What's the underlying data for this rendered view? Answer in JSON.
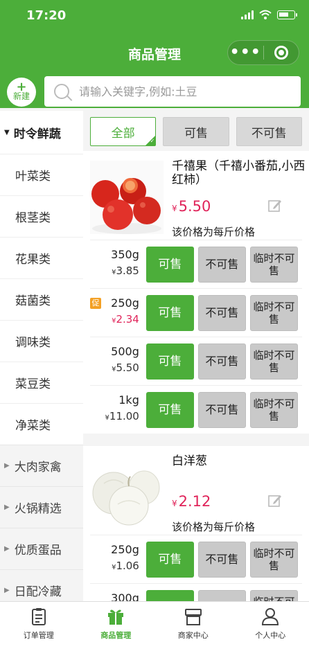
{
  "status": {
    "time": "17:20"
  },
  "nav": {
    "title": "商品管理"
  },
  "toolbar": {
    "new_label": "新建",
    "new_plus": "+",
    "search_placeholder": "请输入关键字,例如:土豆"
  },
  "sidebar": {
    "current": "时令鲜蔬",
    "subcategories": [
      "叶菜类",
      "根茎类",
      "花果类",
      "菇菌类",
      "调味类",
      "菜豆类",
      "净菜类"
    ],
    "other_categories": [
      "大肉家禽",
      "火锅精选",
      "优质蛋品",
      "日配冷藏"
    ]
  },
  "filter_tabs": [
    "全部",
    "可售",
    "不可售"
  ],
  "products": [
    {
      "name": "千禧果（千禧小番茄,小西红柿）",
      "currency": "¥",
      "price": "5.50",
      "note": "该价格为每斤价格",
      "variants": [
        {
          "weight": "350g",
          "price": "3.85",
          "promo": false
        },
        {
          "weight": "250g",
          "price": "2.34",
          "promo": true,
          "promo_label": "促"
        },
        {
          "weight": "500g",
          "price": "5.50",
          "promo": false
        },
        {
          "weight": "1kg",
          "price": "11.00",
          "promo": false
        }
      ]
    },
    {
      "name": "白洋葱",
      "currency": "¥",
      "price": "2.12",
      "note": "该价格为每斤价格",
      "variants": [
        {
          "weight": "250g",
          "price": "1.06",
          "promo": false
        },
        {
          "weight": "300g",
          "price": "",
          "promo": false
        }
      ]
    }
  ],
  "variant_buttons": {
    "on": "可售",
    "off": "不可售",
    "temp": "临时不可售"
  },
  "tabbar": [
    "订单管理",
    "商品管理",
    "商家中心",
    "个人中心"
  ],
  "colors": {
    "brand": "#4cae3a",
    "price": "#e0245a",
    "promo": "#f3a025"
  }
}
